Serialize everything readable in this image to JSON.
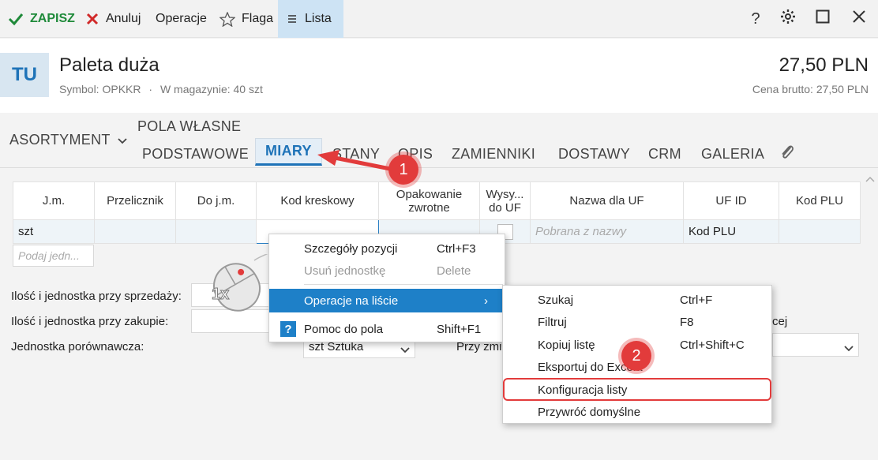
{
  "toolbar": {
    "save": "ZAPISZ",
    "cancel": "Anuluj",
    "operations": "Operacje",
    "flag": "Flaga",
    "list": "Lista",
    "help": "?"
  },
  "header": {
    "avatar": "TU",
    "title": "Paleta duża",
    "symbol": "Symbol: OPKKR",
    "stock": "W magazynie: 40 szt",
    "separator": "·",
    "price": "27,50 PLN",
    "price_gross": "Cena brutto: 27,50 PLN"
  },
  "tabs": {
    "section": "ASORTYMENT",
    "custom_fields": "POLA WŁASNE",
    "items": [
      "PODSTAWOWE",
      "MIARY",
      "STANY",
      "OPIS",
      "ZAMIENNIKI",
      "DOSTAWY",
      "CRM",
      "GALERIA"
    ],
    "active": "MIARY"
  },
  "grid": {
    "columns": [
      "J.m.",
      "Przelicznik",
      "Do j.m.",
      "Kod kreskowy",
      "Opakowanie zwrotne",
      "Wysy... do UF",
      "Nazwa dla UF",
      "UF ID",
      "Kod PLU"
    ],
    "row": {
      "unit": "szt",
      "uf_name_placeholder": "Pobrana z nazwy",
      "uf_id": "Kod PLU"
    },
    "new_row_placeholder": "Podaj jedn..."
  },
  "form": {
    "sale_label": "Ilość i jednostka przy sprzedaży:",
    "purchase_label": "Ilość i jednostka przy zakupie:",
    "compare_label": "Jednostka porównawcza:",
    "compare_value": "szt  Sztuka",
    "change_label": "Przy zmi",
    "partial_text": "cej"
  },
  "context_menu": [
    {
      "label": "Szczegóły pozycji",
      "shortcut": "Ctrl+F3"
    },
    {
      "label": "Usuń jednostkę",
      "shortcut": "Delete"
    },
    {
      "label": "Operacje na liście",
      "shortcut": "›"
    },
    {
      "label": "Pomoc do pola",
      "shortcut": "Shift+F1"
    }
  ],
  "submenu": [
    {
      "label": "Szukaj",
      "shortcut": "Ctrl+F"
    },
    {
      "label": "Filtruj",
      "shortcut": "F8"
    },
    {
      "label": "Kopiuj listę",
      "shortcut": "Ctrl+Shift+C"
    },
    {
      "label": "Eksportuj do Excela",
      "shortcut": ""
    },
    {
      "label": "Konfiguracja listy",
      "shortcut": ""
    },
    {
      "label": "Przywróć domyślne",
      "shortcut": ""
    }
  ],
  "annotations": {
    "callout_1": "1",
    "callout_2": "2",
    "mouse_badge": "1x"
  },
  "colors": {
    "accent": "#1e73b8",
    "save_green": "#1f8a3a",
    "annotation_red": "#e23b3b",
    "menu_highlight": "#1e80c8"
  }
}
